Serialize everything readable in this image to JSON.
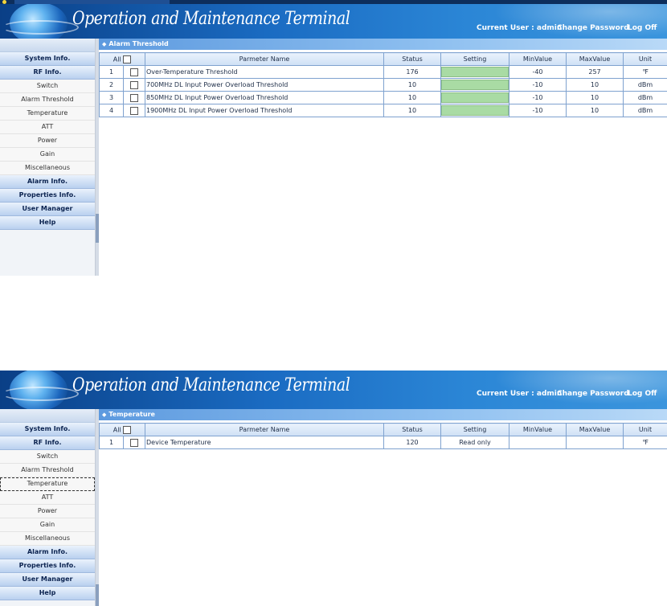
{
  "header": {
    "title": "Operation and Maintenance Terminal",
    "current_user": "Current User : admin",
    "change_password": "Change Password",
    "log_off": "Log Off"
  },
  "sidebar": {
    "items": [
      {
        "label": "System Info.",
        "type": "category"
      },
      {
        "label": "RF Info.",
        "type": "category"
      },
      {
        "label": "Switch",
        "type": "sub"
      },
      {
        "label": "Alarm Threshold",
        "type": "sub"
      },
      {
        "label": "Temperature",
        "type": "sub"
      },
      {
        "label": "ATT",
        "type": "sub"
      },
      {
        "label": "Power",
        "type": "sub"
      },
      {
        "label": "Gain",
        "type": "sub"
      },
      {
        "label": "Miscellaneous",
        "type": "sub"
      },
      {
        "label": "Alarm Info.",
        "type": "category"
      },
      {
        "label": "Properties Info.",
        "type": "category"
      },
      {
        "label": "User Manager",
        "type": "category"
      },
      {
        "label": "Help",
        "type": "category"
      }
    ]
  },
  "table_headers": {
    "all": "All",
    "name": "Parmeter Name",
    "status": "Status",
    "setting": "Setting",
    "min": "MinValue",
    "max": "MaxValue",
    "unit": "Unit"
  },
  "panel1": {
    "section_title": "Alarm Threshold",
    "rows": [
      {
        "no": "1",
        "name": "Over-Temperature Threshold",
        "status": "176",
        "min": "-40",
        "max": "257",
        "unit": "℉"
      },
      {
        "no": "2",
        "name": "700MHz DL Input Power Overload Threshold",
        "status": "10",
        "min": "-10",
        "max": "10",
        "unit": "dBm"
      },
      {
        "no": "3",
        "name": "850MHz DL Input Power Overload Threshold",
        "status": "10",
        "min": "-10",
        "max": "10",
        "unit": "dBm"
      },
      {
        "no": "4",
        "name": "1900MHz DL Input Power Overload Threshold",
        "status": "10",
        "min": "-10",
        "max": "10",
        "unit": "dBm"
      }
    ]
  },
  "panel2": {
    "section_title": "Temperature",
    "rows": [
      {
        "no": "1",
        "name": "Device Temperature",
        "status": "120",
        "setting": "Read only",
        "min": "",
        "max": "",
        "unit": "℉"
      }
    ]
  }
}
